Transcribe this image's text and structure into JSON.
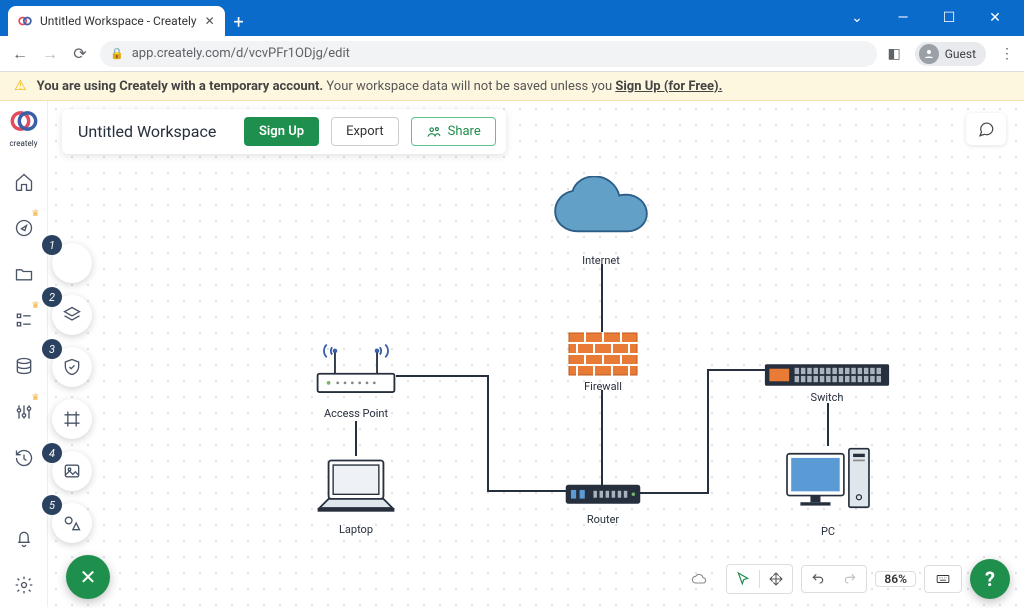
{
  "browser": {
    "tab_title": "Untitled Workspace - Creately",
    "url": "app.creately.com/d/vcvPFr1ODjg/edit",
    "guest_label": "Guest"
  },
  "banner": {
    "bold": "You are using Creately with a temporary account.",
    "rest": " Your workspace data will not be saved unless you ",
    "link": "Sign Up (for Free)."
  },
  "header": {
    "title": "Untitled Workspace",
    "signup": "Sign Up",
    "export": "Export",
    "share": "Share"
  },
  "zoom": "86%",
  "diagram": {
    "internet": "Internet",
    "firewall": "Firewall",
    "access_point": "Access Point",
    "laptop": "Laptop",
    "router": "Router",
    "switch": "Switch",
    "pc": "PC"
  },
  "logo_text": "creately",
  "tool_badges": [
    "1",
    "2",
    "3",
    "4",
    "5"
  ]
}
